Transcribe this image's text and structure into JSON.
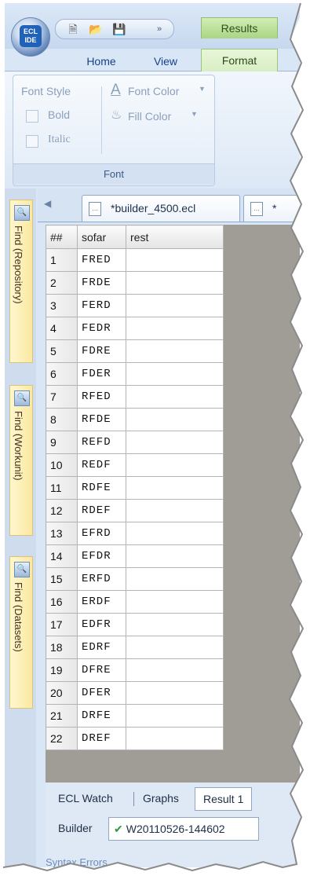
{
  "app": {
    "logo_text": "ECL IDE",
    "colors": {
      "ribbon": "#dce8f7",
      "context_tab": "#b8df93",
      "grid_background": "#a09d97"
    }
  },
  "quick_access": {
    "icons": [
      "new-file-icon",
      "open-folder-icon",
      "save-icon"
    ],
    "overflow_label": "»"
  },
  "ribbon": {
    "context_tab": "Results",
    "tabs": [
      "Home",
      "View",
      "Format"
    ],
    "active_tab": "Format",
    "font_group": {
      "font_style_label": "Font Style",
      "font_color_label": "Font Color",
      "bold_label": "Bold",
      "fill_color_label": "Fill Color",
      "italic_label": "Italic",
      "group_label": "Font"
    }
  },
  "dock": {
    "tabs": [
      "Find (Repository)",
      "Find (Workunit)",
      "Find (Datasets)"
    ]
  },
  "document_tabs": {
    "active_title": "*builder_4500.ecl",
    "second_title": "*"
  },
  "grid": {
    "columns": [
      "##",
      "sofar",
      "rest"
    ],
    "rows": [
      {
        "n": "1",
        "sofar": "FRED",
        "rest": ""
      },
      {
        "n": "2",
        "sofar": "FRDE",
        "rest": ""
      },
      {
        "n": "3",
        "sofar": "FERD",
        "rest": ""
      },
      {
        "n": "4",
        "sofar": "FEDR",
        "rest": ""
      },
      {
        "n": "5",
        "sofar": "FDRE",
        "rest": ""
      },
      {
        "n": "6",
        "sofar": "FDER",
        "rest": ""
      },
      {
        "n": "7",
        "sofar": "RFED",
        "rest": ""
      },
      {
        "n": "8",
        "sofar": "RFDE",
        "rest": ""
      },
      {
        "n": "9",
        "sofar": "REFD",
        "rest": ""
      },
      {
        "n": "10",
        "sofar": "REDF",
        "rest": ""
      },
      {
        "n": "11",
        "sofar": "RDFE",
        "rest": ""
      },
      {
        "n": "12",
        "sofar": "RDEF",
        "rest": ""
      },
      {
        "n": "13",
        "sofar": "EFRD",
        "rest": ""
      },
      {
        "n": "14",
        "sofar": "EFDR",
        "rest": ""
      },
      {
        "n": "15",
        "sofar": "ERFD",
        "rest": ""
      },
      {
        "n": "16",
        "sofar": "ERDF",
        "rest": ""
      },
      {
        "n": "17",
        "sofar": "EDFR",
        "rest": ""
      },
      {
        "n": "18",
        "sofar": "EDRF",
        "rest": ""
      },
      {
        "n": "19",
        "sofar": "DFRE",
        "rest": ""
      },
      {
        "n": "20",
        "sofar": "DFER",
        "rest": ""
      },
      {
        "n": "21",
        "sofar": "DRFE",
        "rest": ""
      },
      {
        "n": "22",
        "sofar": "DREF",
        "rest": ""
      }
    ]
  },
  "bottom": {
    "tabs": [
      "ECL Watch",
      "Graphs",
      "Result 1"
    ],
    "active_tab": "Result 1",
    "builder_label": "Builder",
    "workunit_id": "W20110526-144602",
    "syntax_label": "Syntax Errors"
  }
}
